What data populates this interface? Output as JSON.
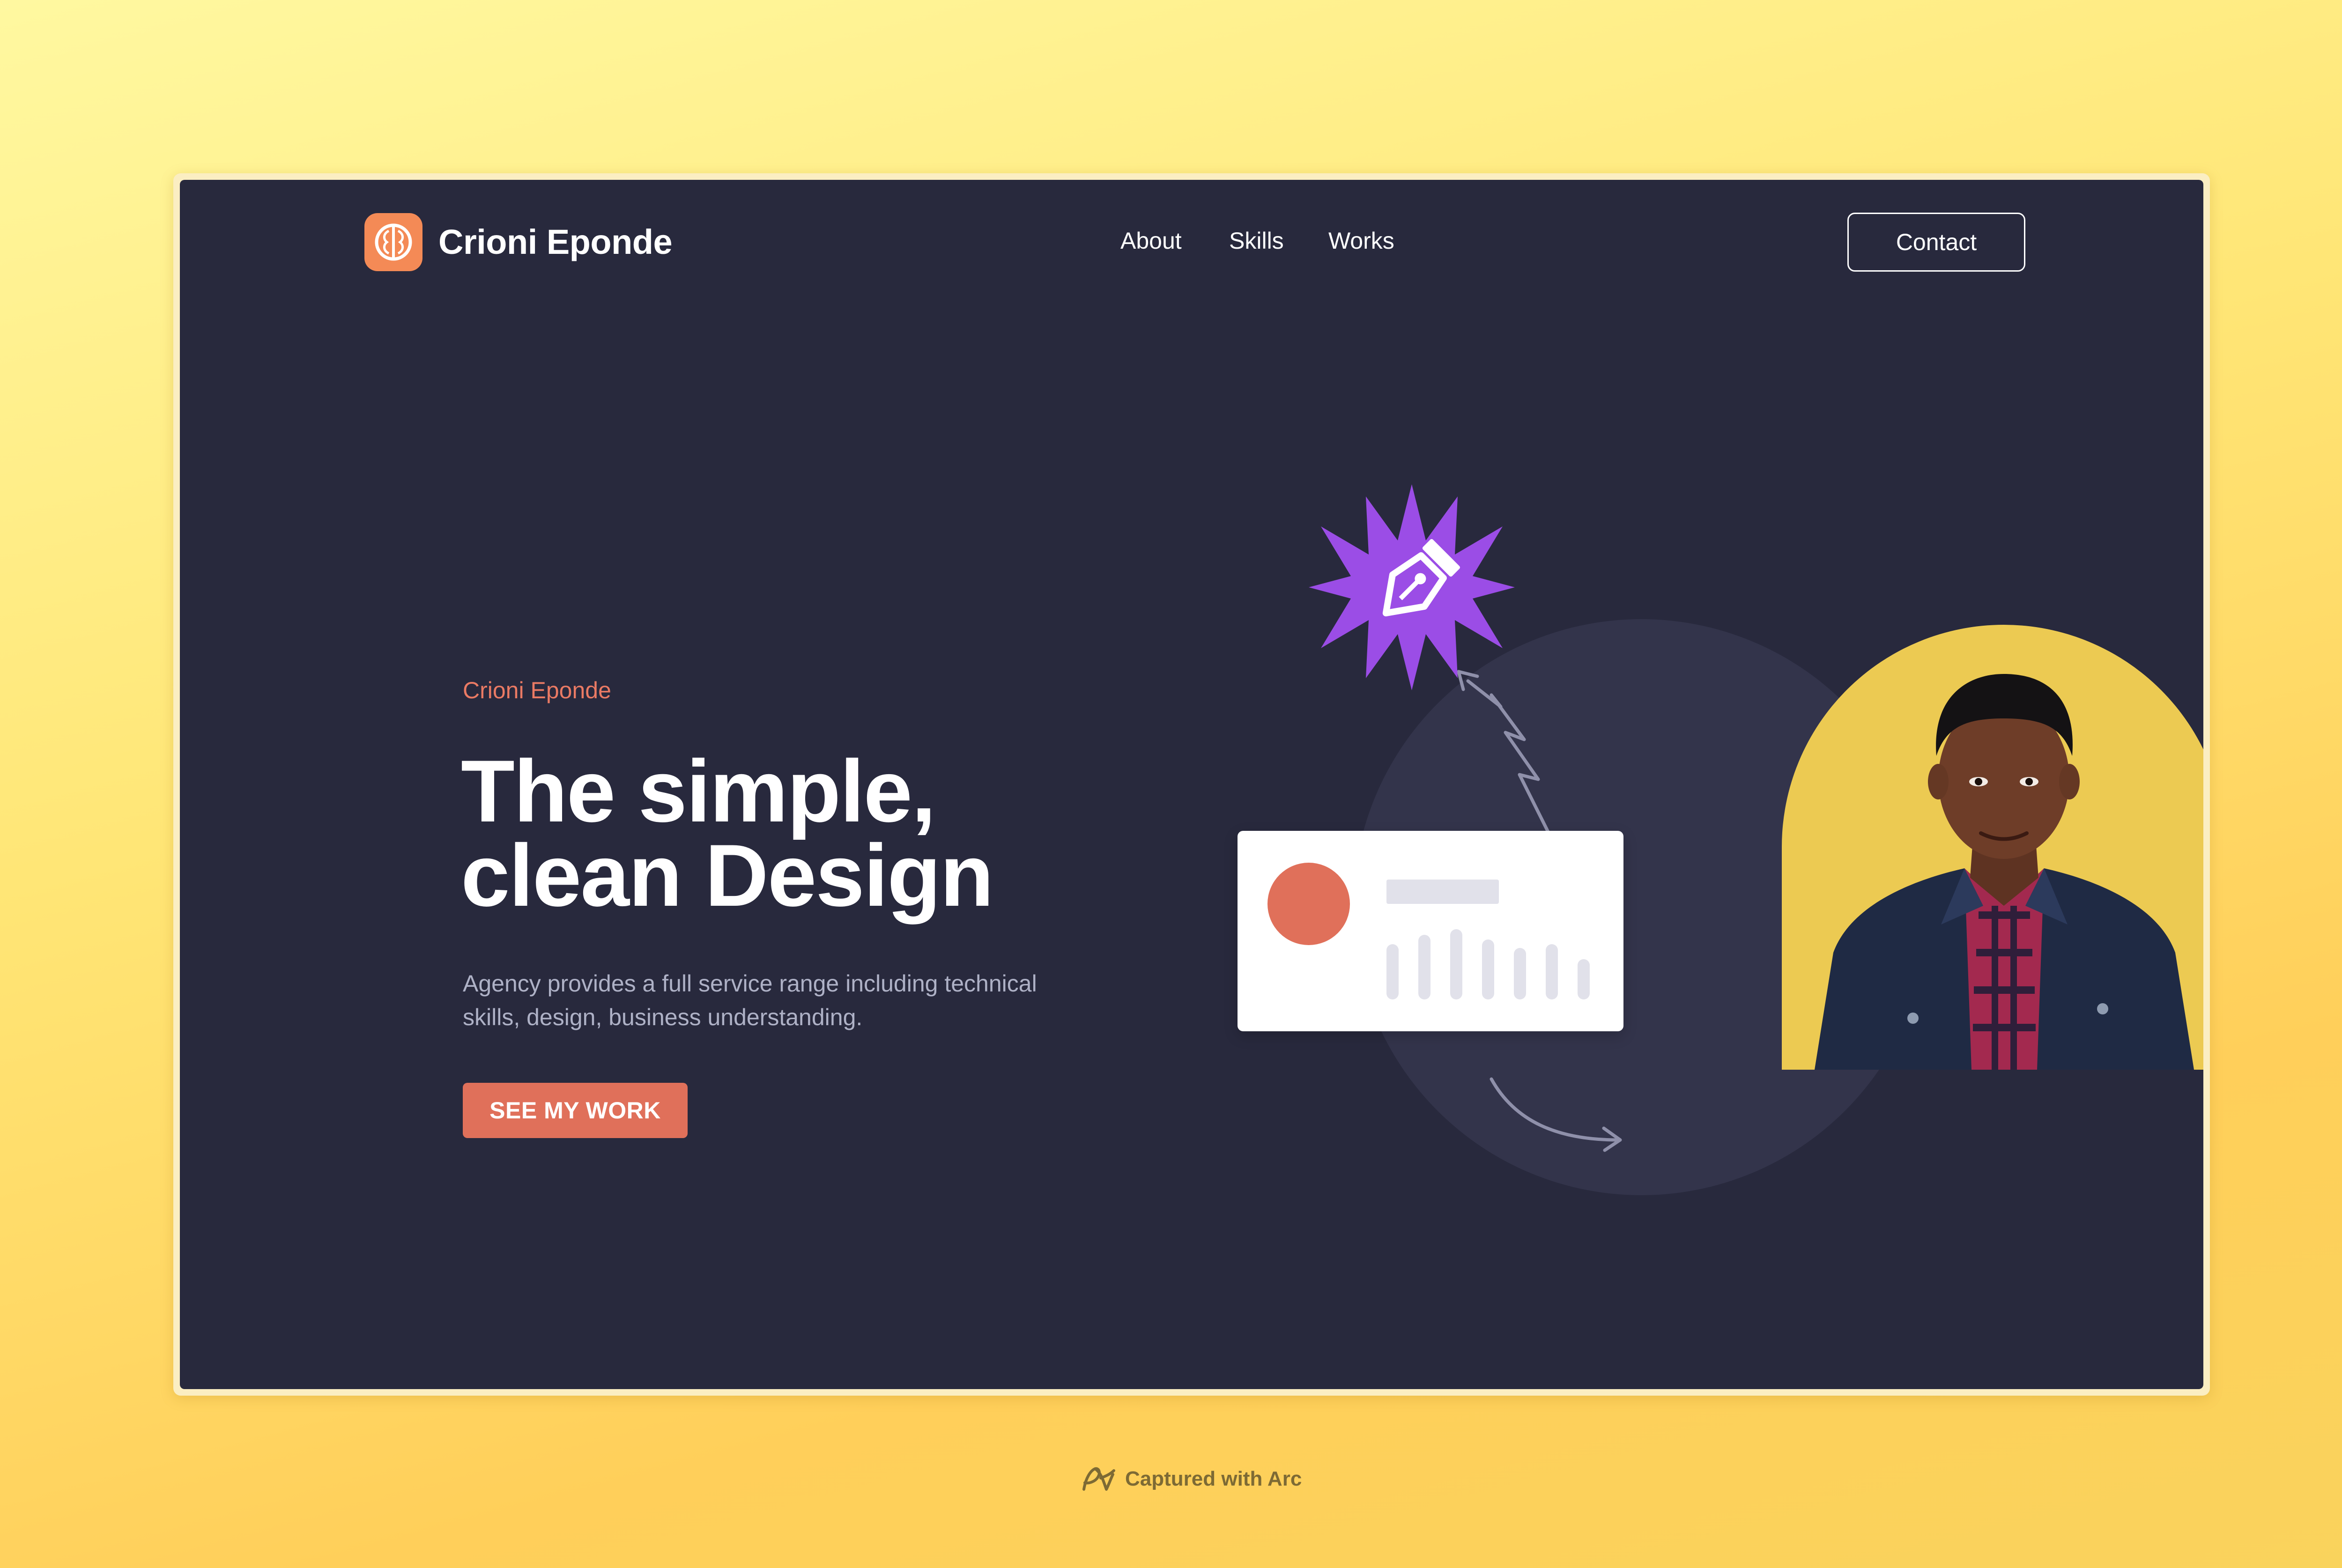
{
  "header": {
    "brand": "Crioni Eponde",
    "nav": [
      "About",
      "Skills",
      "Works"
    ],
    "contact_label": "Contact"
  },
  "hero": {
    "eyebrow": "Crioni Eponde",
    "headline_line1": "The simple,",
    "headline_line2": "clean Design",
    "description": "Agency provides a full service range including technical skills, design, business understanding.",
    "cta_label": "SEE MY WORK"
  },
  "footer": {
    "capture_text": "Captured with Arc"
  },
  "colors": {
    "background_dark": "#28293d",
    "accent_coral": "#e0705a",
    "logo_orange": "#f48a56",
    "badge_purple": "#9b4de6",
    "photo_yellow": "#ecca52"
  },
  "icons": {
    "logo": "brain-icon",
    "badge": "pen-tool-icon",
    "footer": "arc-logo-icon"
  }
}
